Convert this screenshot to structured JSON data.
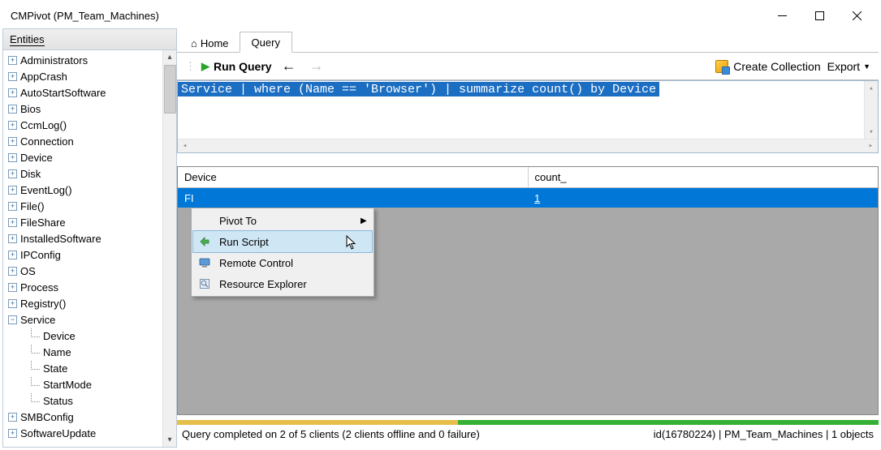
{
  "window_title": "CMPivot (PM_Team_Machines)",
  "sidebar": {
    "header": "Entities",
    "items": [
      {
        "label": "Administrators",
        "expand": "+"
      },
      {
        "label": "AppCrash",
        "expand": "+"
      },
      {
        "label": "AutoStartSoftware",
        "expand": "+"
      },
      {
        "label": "Bios",
        "expand": "+"
      },
      {
        "label": "CcmLog()",
        "expand": "+"
      },
      {
        "label": "Connection",
        "expand": "+"
      },
      {
        "label": "Device",
        "expand": "+"
      },
      {
        "label": "Disk",
        "expand": "+"
      },
      {
        "label": "EventLog()",
        "expand": "+"
      },
      {
        "label": "File()",
        "expand": "+"
      },
      {
        "label": "FileShare",
        "expand": "+"
      },
      {
        "label": "InstalledSoftware",
        "expand": "+"
      },
      {
        "label": "IPConfig",
        "expand": "+"
      },
      {
        "label": "OS",
        "expand": "+"
      },
      {
        "label": "Process",
        "expand": "+"
      },
      {
        "label": "Registry()",
        "expand": "+"
      },
      {
        "label": "Service",
        "expand": "-",
        "children": [
          "Device",
          "Name",
          "State",
          "StartMode",
          "Status"
        ]
      },
      {
        "label": "SMBConfig",
        "expand": "+"
      },
      {
        "label": "SoftwareUpdate",
        "expand": "+"
      }
    ]
  },
  "tabs": {
    "home": "Home",
    "query": "Query"
  },
  "toolbar": {
    "run": "Run Query",
    "create_collection": "Create Collection",
    "export": "Export"
  },
  "query_text": "Service | where (Name == 'Browser') | summarize count() by Device",
  "grid": {
    "columns": [
      "Device",
      "count_"
    ],
    "rows": [
      {
        "device": "FI",
        "count": "1"
      }
    ]
  },
  "context_menu": {
    "items": [
      {
        "label": "Pivot To",
        "submenu": true
      },
      {
        "label": "Run Script",
        "highlight": true
      },
      {
        "label": "Remote Control"
      },
      {
        "label": "Resource Explorer"
      }
    ]
  },
  "status": {
    "message": "Query completed on 2 of 5 clients (2 clients offline and 0 failure)",
    "right": "id(16780224)  |  PM_Team_Machines  |  1 objects"
  }
}
